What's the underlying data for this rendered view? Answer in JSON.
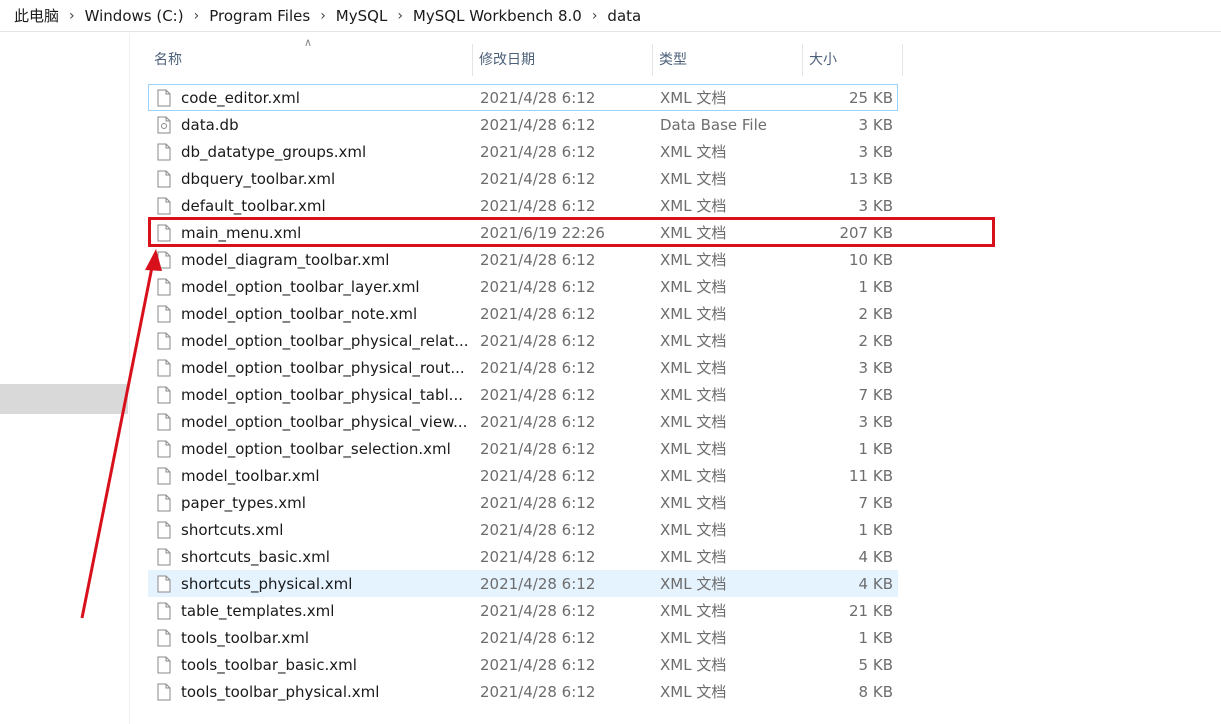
{
  "breadcrumb": [
    "此电脑",
    "Windows (C:)",
    "Program Files",
    "MySQL",
    "MySQL Workbench 8.0",
    "data"
  ],
  "columns": {
    "name": "名称",
    "date": "修改日期",
    "type": "类型",
    "size": "大小"
  },
  "files": [
    {
      "name": "code_editor.xml",
      "date": "2021/4/28 6:12",
      "type": "XML 文档",
      "size": "25 KB"
    },
    {
      "name": "data.db",
      "date": "2021/4/28 6:12",
      "type": "Data Base File",
      "size": "3 KB"
    },
    {
      "name": "db_datatype_groups.xml",
      "date": "2021/4/28 6:12",
      "type": "XML 文档",
      "size": "3 KB"
    },
    {
      "name": "dbquery_toolbar.xml",
      "date": "2021/4/28 6:12",
      "type": "XML 文档",
      "size": "13 KB"
    },
    {
      "name": "default_toolbar.xml",
      "date": "2021/4/28 6:12",
      "type": "XML 文档",
      "size": "3 KB"
    },
    {
      "name": "main_menu.xml",
      "date": "2021/6/19 22:26",
      "type": "XML 文档",
      "size": "207 KB"
    },
    {
      "name": "model_diagram_toolbar.xml",
      "date": "2021/4/28 6:12",
      "type": "XML 文档",
      "size": "10 KB"
    },
    {
      "name": "model_option_toolbar_layer.xml",
      "date": "2021/4/28 6:12",
      "type": "XML 文档",
      "size": "1 KB"
    },
    {
      "name": "model_option_toolbar_note.xml",
      "date": "2021/4/28 6:12",
      "type": "XML 文档",
      "size": "2 KB"
    },
    {
      "name": "model_option_toolbar_physical_relat...",
      "date": "2021/4/28 6:12",
      "type": "XML 文档",
      "size": "2 KB"
    },
    {
      "name": "model_option_toolbar_physical_rout...",
      "date": "2021/4/28 6:12",
      "type": "XML 文档",
      "size": "3 KB"
    },
    {
      "name": "model_option_toolbar_physical_tabl...",
      "date": "2021/4/28 6:12",
      "type": "XML 文档",
      "size": "7 KB"
    },
    {
      "name": "model_option_toolbar_physical_view...",
      "date": "2021/4/28 6:12",
      "type": "XML 文档",
      "size": "3 KB"
    },
    {
      "name": "model_option_toolbar_selection.xml",
      "date": "2021/4/28 6:12",
      "type": "XML 文档",
      "size": "1 KB"
    },
    {
      "name": "model_toolbar.xml",
      "date": "2021/4/28 6:12",
      "type": "XML 文档",
      "size": "11 KB"
    },
    {
      "name": "paper_types.xml",
      "date": "2021/4/28 6:12",
      "type": "XML 文档",
      "size": "7 KB"
    },
    {
      "name": "shortcuts.xml",
      "date": "2021/4/28 6:12",
      "type": "XML 文档",
      "size": "1 KB"
    },
    {
      "name": "shortcuts_basic.xml",
      "date": "2021/4/28 6:12",
      "type": "XML 文档",
      "size": "4 KB"
    },
    {
      "name": "shortcuts_physical.xml",
      "date": "2021/4/28 6:12",
      "type": "XML 文档",
      "size": "4 KB"
    },
    {
      "name": "table_templates.xml",
      "date": "2021/4/28 6:12",
      "type": "XML 文档",
      "size": "21 KB"
    },
    {
      "name": "tools_toolbar.xml",
      "date": "2021/4/28 6:12",
      "type": "XML 文档",
      "size": "1 KB"
    },
    {
      "name": "tools_toolbar_basic.xml",
      "date": "2021/4/28 6:12",
      "type": "XML 文档",
      "size": "5 KB"
    },
    {
      "name": "tools_toolbar_physical.xml",
      "date": "2021/4/28 6:12",
      "type": "XML 文档",
      "size": "8 KB"
    }
  ],
  "colors": {
    "annotation": "#d7101c",
    "hover_row": "#e5f3ff",
    "focus_border": "#99d1ff",
    "header_text": "#4c607a"
  }
}
